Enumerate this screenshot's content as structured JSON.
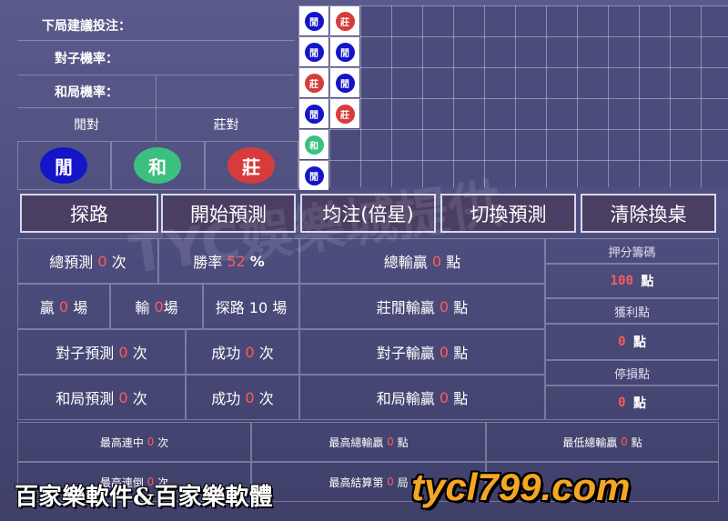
{
  "left_panel": {
    "next_bet_label": "下局建議投注：",
    "pair_rate_label": "對子機率：",
    "tie_rate_label": "和局機率：",
    "player_pair_label": "閒對",
    "banker_pair_label": "莊對",
    "player_button": "閒",
    "tie_button": "和",
    "banker_button": "莊"
  },
  "bead_road": [
    {
      "col": 0,
      "row": 0,
      "type": "player",
      "text": "閒"
    },
    {
      "col": 0,
      "row": 1,
      "type": "player",
      "text": "閒"
    },
    {
      "col": 0,
      "row": 2,
      "type": "banker",
      "text": "莊"
    },
    {
      "col": 0,
      "row": 3,
      "type": "player",
      "text": "閒"
    },
    {
      "col": 0,
      "row": 4,
      "type": "tie",
      "text": "和"
    },
    {
      "col": 0,
      "row": 5,
      "type": "player",
      "text": "閒"
    },
    {
      "col": 1,
      "row": 0,
      "type": "banker",
      "text": "莊"
    },
    {
      "col": 1,
      "row": 1,
      "type": "player",
      "text": "閒"
    },
    {
      "col": 1,
      "row": 2,
      "type": "player",
      "text": "閒"
    },
    {
      "col": 1,
      "row": 3,
      "type": "banker",
      "text": "莊"
    }
  ],
  "toolbar": {
    "explore": "探路",
    "start_predict": "開始預測",
    "flat_bet": "均注(倍星)",
    "switch_predict": "切換預測",
    "clear_table": "清除換桌"
  },
  "stats": {
    "total_predict_label": "總預測",
    "total_predict_value": "0",
    "times_unit": "次",
    "win_rate_label": "勝率",
    "win_rate_value": "52",
    "percent": "%",
    "total_winloss_label": "總輸贏",
    "total_winloss_value": "0",
    "points_unit": "點",
    "win_label": "贏",
    "win_value": "0",
    "games_unit": "場",
    "lose_label": "輸",
    "lose_value": "0",
    "explore_games": "探路 10 場",
    "bp_winloss_label": "莊閒輸贏",
    "bp_winloss_value": "0",
    "pair_predict_label": "對子預測",
    "pair_predict_value": "0",
    "success_label": "成功",
    "pair_success_value": "0",
    "pair_winloss_label": "對子輸贏",
    "pair_winloss_value": "0",
    "tie_predict_label": "和局預測",
    "tie_predict_value": "0",
    "tie_success_value": "0",
    "tie_winloss_label": "和局輸贏",
    "tie_winloss_value": "0"
  },
  "right_panel": {
    "chips_title": "押分籌碼",
    "chips_value": "100",
    "profit_title": "獲利點",
    "profit_value": "0",
    "stop_loss_title": "停損點",
    "stop_loss_value": "0",
    "points_unit": "點"
  },
  "bottom": {
    "max_win_streak_label": "最高連中",
    "max_win_streak_value": "0",
    "max_total_win_label": "最高總輸贏",
    "max_total_win_value": "0",
    "min_total_win_label": "最低總輸贏",
    "min_total_win_value": "0",
    "max_lose_streak_label": "最高連倒",
    "max_lose_streak_value": "0",
    "max_result_label": "最高結算第",
    "max_result_value": "0",
    "round_unit": "局"
  },
  "watermark": {
    "left_text": "百家樂軟件&百家樂軟體",
    "right_text": "tycl799.com",
    "center_text": "TYC娛樂城提供"
  },
  "colors": {
    "player": "#1515c8",
    "banker": "#d63c3c",
    "tie": "#3cc080",
    "highlight_number": "#ff5a5a"
  }
}
